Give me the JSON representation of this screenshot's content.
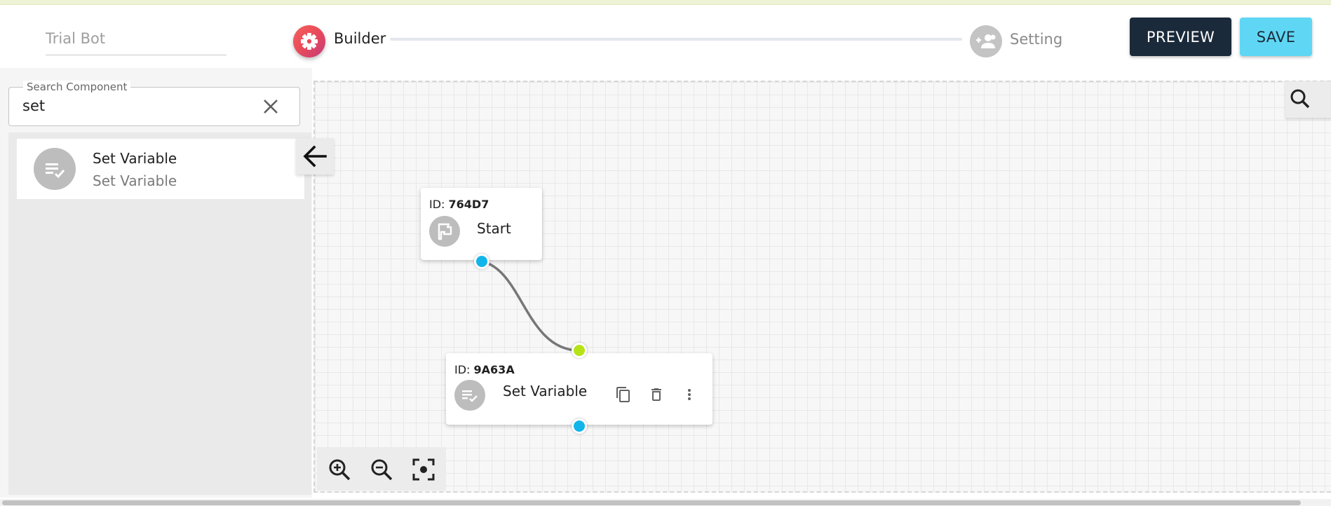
{
  "header": {
    "bot_name": "Trial Bot",
    "steps": [
      {
        "label": "Builder",
        "active": true,
        "icon": "gear-icon"
      },
      {
        "label": "Setting",
        "active": false,
        "icon": "group-add-icon"
      }
    ],
    "preview_label": "PREVIEW",
    "save_label": "SAVE"
  },
  "sidebar": {
    "search_label": "Search Component",
    "search_value": "set",
    "results": [
      {
        "title": "Set Variable",
        "subtitle": "Set Variable",
        "icon": "set-variable-icon"
      }
    ]
  },
  "canvas": {
    "nodes": [
      {
        "id_prefix": "ID:",
        "id": "764D7",
        "label": "Start",
        "icon": "flag-icon"
      },
      {
        "id_prefix": "ID:",
        "id": "9A63A",
        "label": "Set Variable",
        "icon": "set-variable-icon",
        "actions": [
          "copy-icon",
          "delete-icon",
          "more-vert-icon"
        ]
      }
    ],
    "zoom_controls": [
      "zoom-in-icon",
      "zoom-out-icon",
      "fit-view-icon"
    ]
  },
  "colors": {
    "primary_dark": "#1b2a3a",
    "accent_cyan": "#5fd7f4",
    "handle_blue": "#12b5ea",
    "handle_green": "#b6e317",
    "builder_gradient_start": "#f5615c",
    "builder_gradient_end": "#c23a7a"
  }
}
